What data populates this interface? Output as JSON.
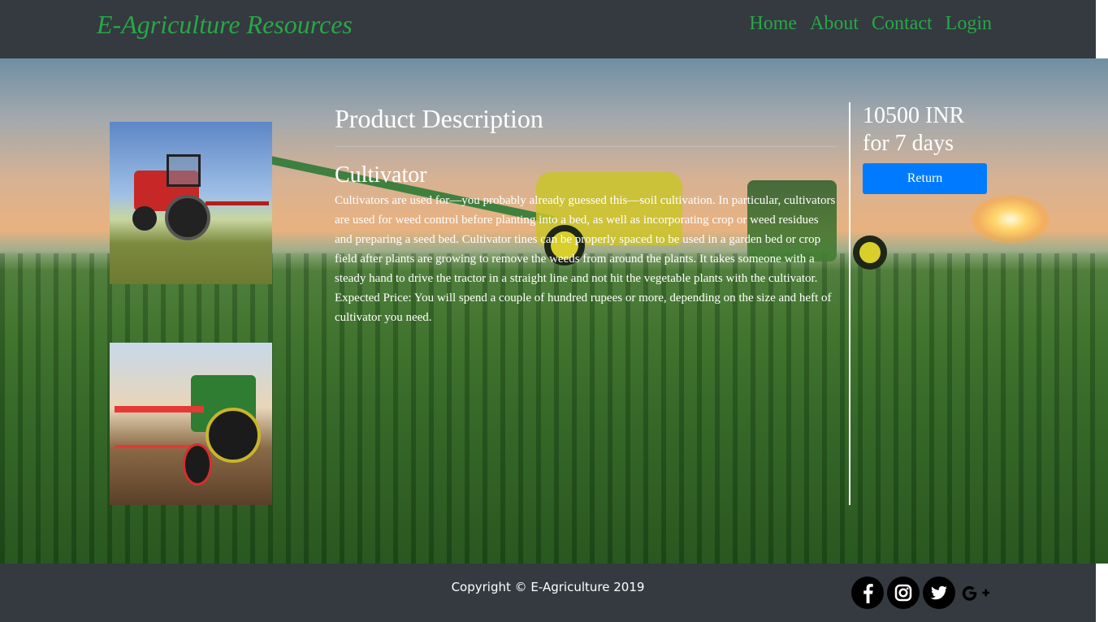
{
  "header": {
    "brand": "E-Agriculture Resources",
    "nav": [
      "Home",
      "About",
      "Contact",
      "Login"
    ]
  },
  "product": {
    "section_title": "Product Description",
    "name": "Cultivator",
    "description": "Cultivators are used for—you probably already guessed this—soil cultivation. In particular, cultivators are used for weed control before planting into a bed, as well as incorporating crop or weed residues and preparing a seed bed. Cultivator tines can be properly spaced to be used in a garden bed or crop field after plants are growing to remove the weeds from around the plants. It takes someone with a steady hand to drive the tractor in a straight line and not hit the vegetable plants with the cultivator. Expected Price: You will spend a couple of hundred rupees or more, depending on the size and heft of cultivator you need.",
    "price": "10500 INR",
    "duration": "for 7 days",
    "return_label": "Return"
  },
  "footer": {
    "copyright": "Copyright © E-Agriculture 2019",
    "social": [
      "facebook-icon",
      "instagram-icon",
      "twitter-icon",
      "google-plus-icon"
    ]
  },
  "colors": {
    "header_bg": "#343a40",
    "brand": "#28a745",
    "button": "#007bff"
  }
}
